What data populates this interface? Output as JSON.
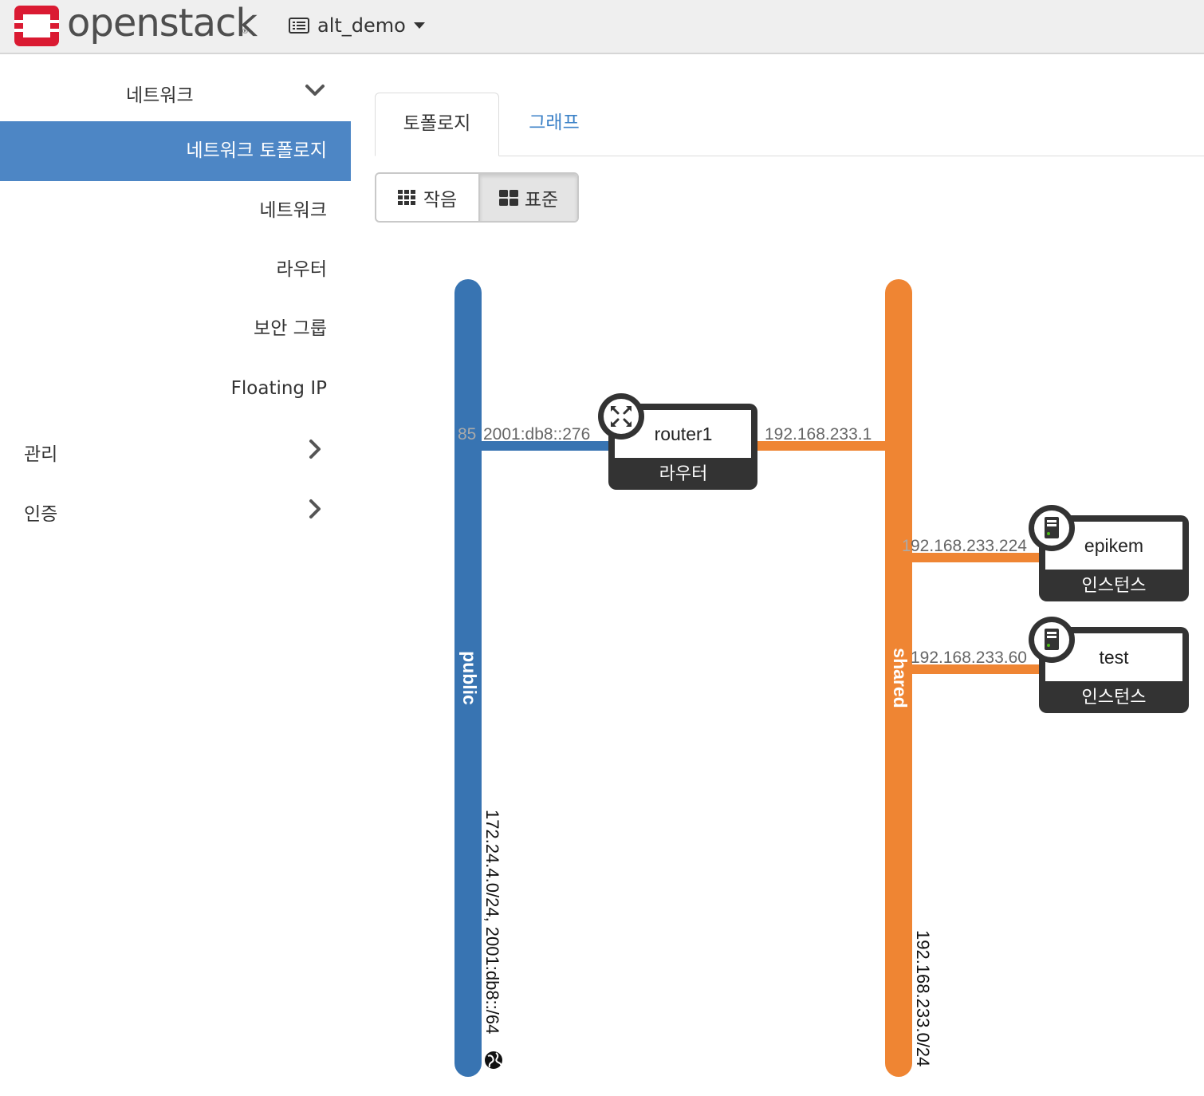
{
  "header": {
    "brand": "openstack",
    "brand_reg": "®",
    "project": "alt_demo"
  },
  "sidebar": {
    "network_section": "네트워크",
    "items": [
      {
        "label": "네트워크 토폴로지",
        "active": true
      },
      {
        "label": "네트워크"
      },
      {
        "label": "라우터"
      },
      {
        "label": "보안 그룹"
      },
      {
        "label": "Floating IP"
      }
    ],
    "admin_section": "관리",
    "identity_section": "인증"
  },
  "tabs": [
    {
      "label": "토폴로지",
      "active": true
    },
    {
      "label": "그래프"
    }
  ],
  "view_toggle": {
    "small_label": "작음",
    "normal_label": "표준",
    "selected": "표준"
  },
  "topology": {
    "colors": {
      "public": "#3874b2",
      "shared": "#ef8533",
      "device": "#333333",
      "port_text": "#666666"
    },
    "networks": [
      {
        "name": "public",
        "subnets": "172.24.4.0/24, 2001:db8::/64",
        "external": true,
        "globe_icon": "globe-icon"
      },
      {
        "name": "shared",
        "subnets": "192.168.233.0/24"
      }
    ],
    "router": {
      "name": "router1",
      "type": "라우터",
      "icon": "router-arrows-icon",
      "port_public_prefix": "85",
      "port_public": "2001:db8::276",
      "port_shared": "192.168.233.1"
    },
    "instances": [
      {
        "name": "epikem",
        "type": "인스턴스",
        "ip_prefix": "1",
        "ip": "92.168.233.224",
        "icon": "server-icon"
      },
      {
        "name": "test",
        "type": "인스턴스",
        "ip": "192.168.233.60",
        "icon": "server-icon"
      }
    ]
  }
}
